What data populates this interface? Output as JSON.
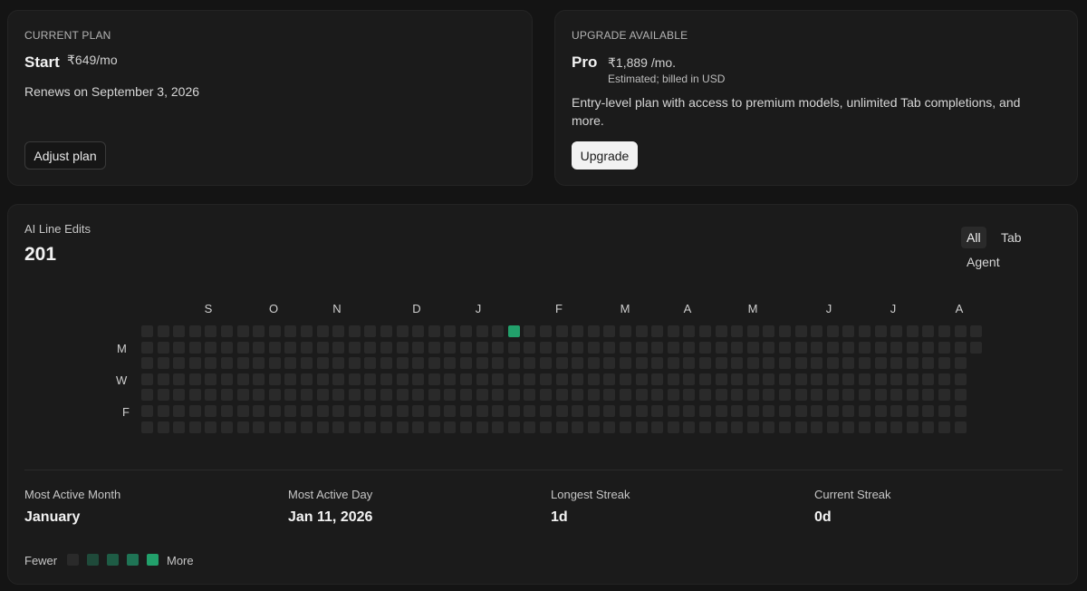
{
  "current_plan": {
    "eyebrow": "CURRENT PLAN",
    "name": "Start",
    "price": "₹649/mo",
    "renews": "Renews on September 3, 2026",
    "adjust_label": "Adjust plan"
  },
  "upgrade": {
    "eyebrow": "UPGRADE AVAILABLE",
    "name": "Pro",
    "price": "₹1,889 /mo.",
    "note": "Estimated; billed in USD",
    "description": "Entry-level plan with access to premium models, unlimited Tab completions, and more.",
    "button_label": "Upgrade"
  },
  "usage": {
    "metric_label": "AI Line Edits",
    "metric_value": "201",
    "filters": [
      {
        "label": "All",
        "active": true
      },
      {
        "label": "Tab",
        "active": false
      },
      {
        "label": "Agent",
        "active": false
      }
    ],
    "months": [
      "S",
      "O",
      "N",
      "D",
      "J",
      "F",
      "M",
      "A",
      "M",
      "J",
      "J",
      "A"
    ],
    "day_labels": [
      "M",
      "W",
      "F"
    ],
    "heatmap": {
      "weeks": 53,
      "rows": 7,
      "last_week_days": 2,
      "active_cells": [
        {
          "week": 23,
          "day": 0,
          "level": 4
        }
      ],
      "colors": [
        "#2a2a2a",
        "#1f4a3a",
        "#1e5c45",
        "#1f7455",
        "#22a06b"
      ]
    },
    "stats": [
      {
        "label": "Most Active Month",
        "value": "January"
      },
      {
        "label": "Most Active Day",
        "value": "Jan 11, 2026"
      },
      {
        "label": "Longest Streak",
        "value": "1d"
      },
      {
        "label": "Current Streak",
        "value": "0d"
      }
    ],
    "legend": {
      "fewer": "Fewer",
      "more": "More",
      "colors": [
        "#2a2a2a",
        "#1f4a3a",
        "#1e5c45",
        "#1f7455",
        "#22a06b"
      ]
    }
  }
}
